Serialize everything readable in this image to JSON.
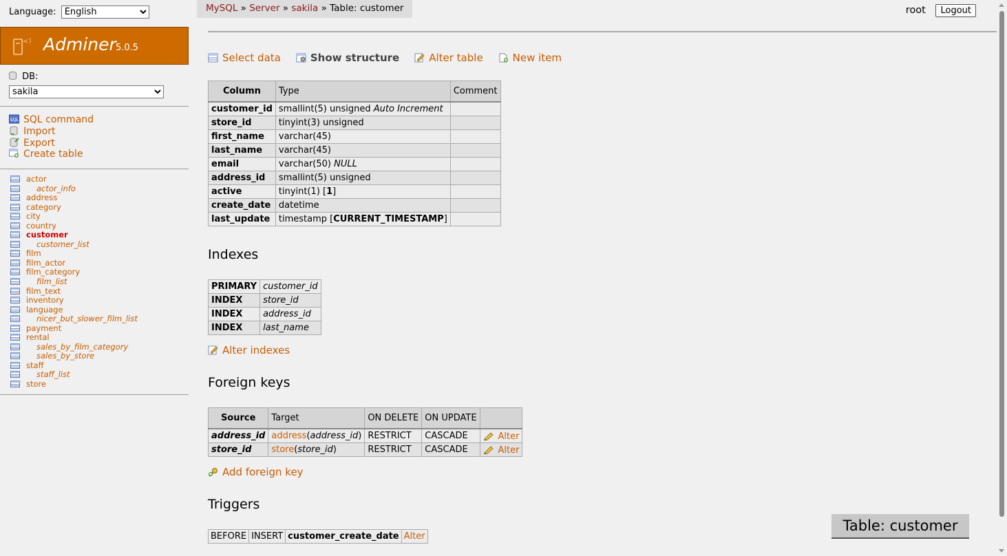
{
  "sidebar": {
    "language_label": "Language:",
    "language_value": "English",
    "brand": "Adminer",
    "version": "5.0.5",
    "db_label": "DB:",
    "db_value": "sakila",
    "links": [
      {
        "label": "SQL command",
        "icon": "sql-icon"
      },
      {
        "label": "Import",
        "icon": "import-icon"
      },
      {
        "label": "Export",
        "icon": "export-icon"
      },
      {
        "label": "Create table",
        "icon": "create-table-icon"
      }
    ],
    "tables": [
      {
        "name": "actor",
        "view": false
      },
      {
        "name": "actor_info",
        "view": true
      },
      {
        "name": "address",
        "view": false
      },
      {
        "name": "category",
        "view": false
      },
      {
        "name": "city",
        "view": false
      },
      {
        "name": "country",
        "view": false
      },
      {
        "name": "customer",
        "view": false,
        "active": true
      },
      {
        "name": "customer_list",
        "view": true
      },
      {
        "name": "film",
        "view": false
      },
      {
        "name": "film_actor",
        "view": false
      },
      {
        "name": "film_category",
        "view": false
      },
      {
        "name": "film_list",
        "view": true
      },
      {
        "name": "film_text",
        "view": false
      },
      {
        "name": "inventory",
        "view": false
      },
      {
        "name": "language",
        "view": false
      },
      {
        "name": "nicer_but_slower_film_list",
        "view": true
      },
      {
        "name": "payment",
        "view": false
      },
      {
        "name": "rental",
        "view": false
      },
      {
        "name": "sales_by_film_category",
        "view": true
      },
      {
        "name": "sales_by_store",
        "view": true
      },
      {
        "name": "staff",
        "view": false
      },
      {
        "name": "staff_list",
        "view": true
      },
      {
        "name": "store",
        "view": false
      }
    ]
  },
  "breadcrumb": {
    "mysql": "MySQL",
    "sep": "»",
    "server": "Server",
    "db": "sakila",
    "current": "Table: customer"
  },
  "user": {
    "name": "root",
    "logout": "Logout"
  },
  "actions": [
    {
      "label": "Select data",
      "current": false,
      "icon": "select-icon"
    },
    {
      "label": "Show structure",
      "current": true,
      "icon": "structure-icon"
    },
    {
      "label": "Alter table",
      "current": false,
      "icon": "alter-icon"
    },
    {
      "label": "New item",
      "current": false,
      "icon": "new-item-icon"
    }
  ],
  "columns_table": {
    "headers": [
      "Column",
      "Type",
      "Comment"
    ],
    "rows": [
      {
        "column": "customer_id",
        "type": "smallint(5) unsigned",
        "extra": "Auto Increment",
        "default": "",
        "comment": ""
      },
      {
        "column": "store_id",
        "type": "tinyint(3) unsigned",
        "extra": "",
        "default": "",
        "comment": ""
      },
      {
        "column": "first_name",
        "type": "varchar(45)",
        "extra": "",
        "default": "",
        "comment": ""
      },
      {
        "column": "last_name",
        "type": "varchar(45)",
        "extra": "",
        "default": "",
        "comment": ""
      },
      {
        "column": "email",
        "type": "varchar(50)",
        "extra": "NULL",
        "default": "",
        "comment": ""
      },
      {
        "column": "address_id",
        "type": "smallint(5) unsigned",
        "extra": "",
        "default": "",
        "comment": ""
      },
      {
        "column": "active",
        "type": "tinyint(1)",
        "extra": "",
        "default": "1",
        "comment": ""
      },
      {
        "column": "create_date",
        "type": "datetime",
        "extra": "",
        "default": "",
        "comment": ""
      },
      {
        "column": "last_update",
        "type": "timestamp",
        "extra": "",
        "default": "CURRENT_TIMESTAMP",
        "comment": ""
      }
    ]
  },
  "indexes": {
    "title": "Indexes",
    "rows": [
      {
        "kind": "PRIMARY",
        "cols": "customer_id"
      },
      {
        "kind": "INDEX",
        "cols": "store_id"
      },
      {
        "kind": "INDEX",
        "cols": "address_id"
      },
      {
        "kind": "INDEX",
        "cols": "last_name"
      }
    ],
    "alter_link": "Alter indexes"
  },
  "foreign_keys": {
    "title": "Foreign keys",
    "headers": [
      "Source",
      "Target",
      "ON DELETE",
      "ON UPDATE",
      ""
    ],
    "rows": [
      {
        "source": "address_id",
        "target_table": "address",
        "target_col": "address_id",
        "on_delete": "RESTRICT",
        "on_update": "CASCADE",
        "alter": "Alter"
      },
      {
        "source": "store_id",
        "target_table": "store",
        "target_col": "store_id",
        "on_delete": "RESTRICT",
        "on_update": "CASCADE",
        "alter": "Alter"
      }
    ],
    "add_link": "Add foreign key"
  },
  "triggers": {
    "title": "Triggers",
    "rows": [
      {
        "timing": "BEFORE",
        "event": "INSERT",
        "name": "customer_create_date",
        "alter": "Alter"
      }
    ]
  },
  "floating_title": "Table: customer"
}
